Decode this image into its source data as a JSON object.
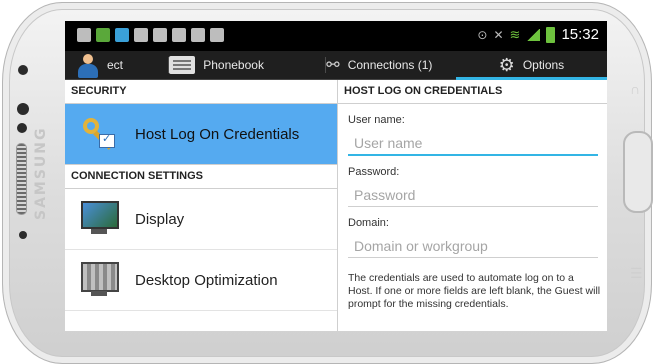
{
  "device": {
    "brand": "SAMSUNG"
  },
  "status_bar": {
    "time": "15:32",
    "icons_left": [
      "notification-icon",
      "android-icon",
      "app-icon",
      "mail-icon",
      "message-icon",
      "cloud-icon",
      "bag-icon",
      "bag-icon"
    ],
    "icons_right": [
      "alarm-icon",
      "mute-icon",
      "wifi-icon",
      "signal-icon",
      "battery-icon"
    ]
  },
  "action_bar": {
    "tabs": [
      {
        "label": "ect",
        "icon": "person-icon"
      },
      {
        "label": "Phonebook",
        "icon": "phonebook-icon"
      },
      {
        "label": "Connections (1)",
        "icon": "connections-icon"
      },
      {
        "label": "Options",
        "icon": "gear-icon",
        "selected": true
      }
    ],
    "accent": "#33b5e5"
  },
  "left_pane": {
    "security_header": "SECURITY",
    "security_items": [
      {
        "label": "Host Log On Credentials",
        "icon": "key-icon",
        "selected": true
      }
    ],
    "connection_header": "CONNECTION SETTINGS",
    "connection_items": [
      {
        "label": "Display",
        "icon": "monitor-icon"
      },
      {
        "label": "Desktop Optimization",
        "icon": "optimization-icon"
      }
    ],
    "selected_color": "#55aaf0"
  },
  "right_pane": {
    "header": "HOST LOG ON CREDENTIALS",
    "username_label": "User name:",
    "username_placeholder": "User name",
    "password_label": "Password:",
    "password_placeholder": "Password",
    "domain_label": "Domain:",
    "domain_placeholder": "Domain or workgroup",
    "note": "The credentials are used to automate log on to a Host. If one or more fields are left blank, the Guest will prompt for the missing credentials."
  }
}
